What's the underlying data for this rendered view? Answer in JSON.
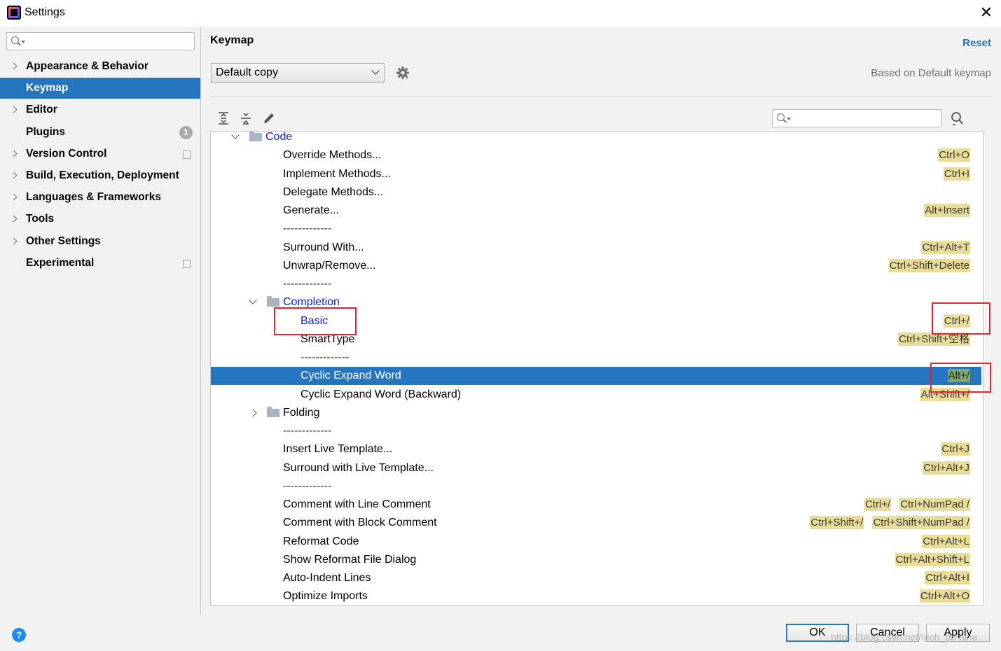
{
  "window": {
    "title": "Settings",
    "close_glyph": "✕"
  },
  "sidebar": {
    "search_placeholder": "",
    "items": [
      {
        "label": "Appearance & Behavior",
        "expandable": true
      },
      {
        "label": "Keymap",
        "selected": true
      },
      {
        "label": "Editor",
        "expandable": true
      },
      {
        "label": "Plugins",
        "badge": "1"
      },
      {
        "label": "Version Control",
        "expandable": true,
        "icon": "copy-icon"
      },
      {
        "label": "Build, Execution, Deployment",
        "expandable": true
      },
      {
        "label": "Languages & Frameworks",
        "expandable": true
      },
      {
        "label": "Tools",
        "expandable": true
      },
      {
        "label": "Other Settings",
        "expandable": true
      },
      {
        "label": "Experimental",
        "icon": "copy-icon"
      }
    ]
  },
  "main": {
    "title": "Keymap",
    "reset_label": "Reset",
    "keymap_select": "Default copy",
    "based_on": "Based on Default keymap",
    "toolbar_icons": [
      "expand-all-icon",
      "collapse-all-icon",
      "edit-icon"
    ],
    "tree_search_placeholder": "",
    "find_shortcut_icon": "find-shortcut-icon"
  },
  "tree": [
    {
      "depth": 0,
      "kind": "group",
      "expanded": true,
      "label": "Code",
      "keys": []
    },
    {
      "depth": 1,
      "label": "Override Methods...",
      "keys": [
        "Ctrl+O"
      ]
    },
    {
      "depth": 1,
      "label": "Implement Methods...",
      "keys": [
        "Ctrl+I"
      ]
    },
    {
      "depth": 1,
      "label": "Delegate Methods...",
      "keys": []
    },
    {
      "depth": 1,
      "label": "Generate...",
      "keys": [
        "Alt+Insert"
      ]
    },
    {
      "depth": 1,
      "kind": "separator",
      "label": "-------------",
      "keys": []
    },
    {
      "depth": 1,
      "label": "Surround With...",
      "keys": [
        "Ctrl+Alt+T"
      ]
    },
    {
      "depth": 1,
      "label": "Unwrap/Remove...",
      "keys": [
        "Ctrl+Shift+Delete"
      ]
    },
    {
      "depth": 1,
      "kind": "separator",
      "label": "-------------",
      "keys": []
    },
    {
      "depth": 1,
      "kind": "group",
      "expanded": true,
      "label": "Completion",
      "keys": []
    },
    {
      "depth": 2,
      "kind": "link",
      "label": "Basic",
      "keys": [
        "Ctrl+/"
      ]
    },
    {
      "depth": 2,
      "label": "SmartType",
      "keys": [
        "Ctrl+Shift+空格"
      ]
    },
    {
      "depth": 2,
      "kind": "separator",
      "label": "-------------",
      "keys": []
    },
    {
      "depth": 2,
      "label": "Cyclic Expand Word",
      "keys": [
        "Alt+/"
      ],
      "selected": true
    },
    {
      "depth": 2,
      "label": "Cyclic Expand Word (Backward)",
      "keys": [
        "Alt+Shift+/"
      ]
    },
    {
      "depth": 1,
      "kind": "group",
      "expanded": false,
      "label": "Folding",
      "keys": [],
      "plain": true
    },
    {
      "depth": 1,
      "kind": "separator",
      "label": "-------------",
      "keys": []
    },
    {
      "depth": 1,
      "label": "Insert Live Template...",
      "keys": [
        "Ctrl+J"
      ]
    },
    {
      "depth": 1,
      "label": "Surround with Live Template...",
      "keys": [
        "Ctrl+Alt+J"
      ]
    },
    {
      "depth": 1,
      "kind": "separator",
      "label": "-------------",
      "keys": []
    },
    {
      "depth": 1,
      "label": "Comment with Line Comment",
      "keys": [
        "Ctrl+/",
        "Ctrl+NumPad /"
      ]
    },
    {
      "depth": 1,
      "label": "Comment with Block Comment",
      "keys": [
        "Ctrl+Shift+/",
        "Ctrl+Shift+NumPad /"
      ]
    },
    {
      "depth": 1,
      "label": "Reformat Code",
      "keys": [
        "Ctrl+Alt+L"
      ]
    },
    {
      "depth": 1,
      "label": "Show Reformat File Dialog",
      "keys": [
        "Ctrl+Alt+Shift+L"
      ]
    },
    {
      "depth": 1,
      "label": "Auto-Indent Lines",
      "keys": [
        "Ctrl+Alt+I"
      ]
    },
    {
      "depth": 1,
      "label": "Optimize Imports",
      "keys": [
        "Ctrl+Alt+O"
      ]
    }
  ],
  "buttons": {
    "ok": "OK",
    "cancel": "Cancel",
    "apply": "Apply",
    "help": "?"
  },
  "watermark": "https://blog.csdn.net/tech_bb nine",
  "colors": {
    "selection": "#2675bf",
    "link": "#0d1ecc",
    "shortcut_bg": "#e9dc96",
    "annotation": "#e0262f"
  }
}
